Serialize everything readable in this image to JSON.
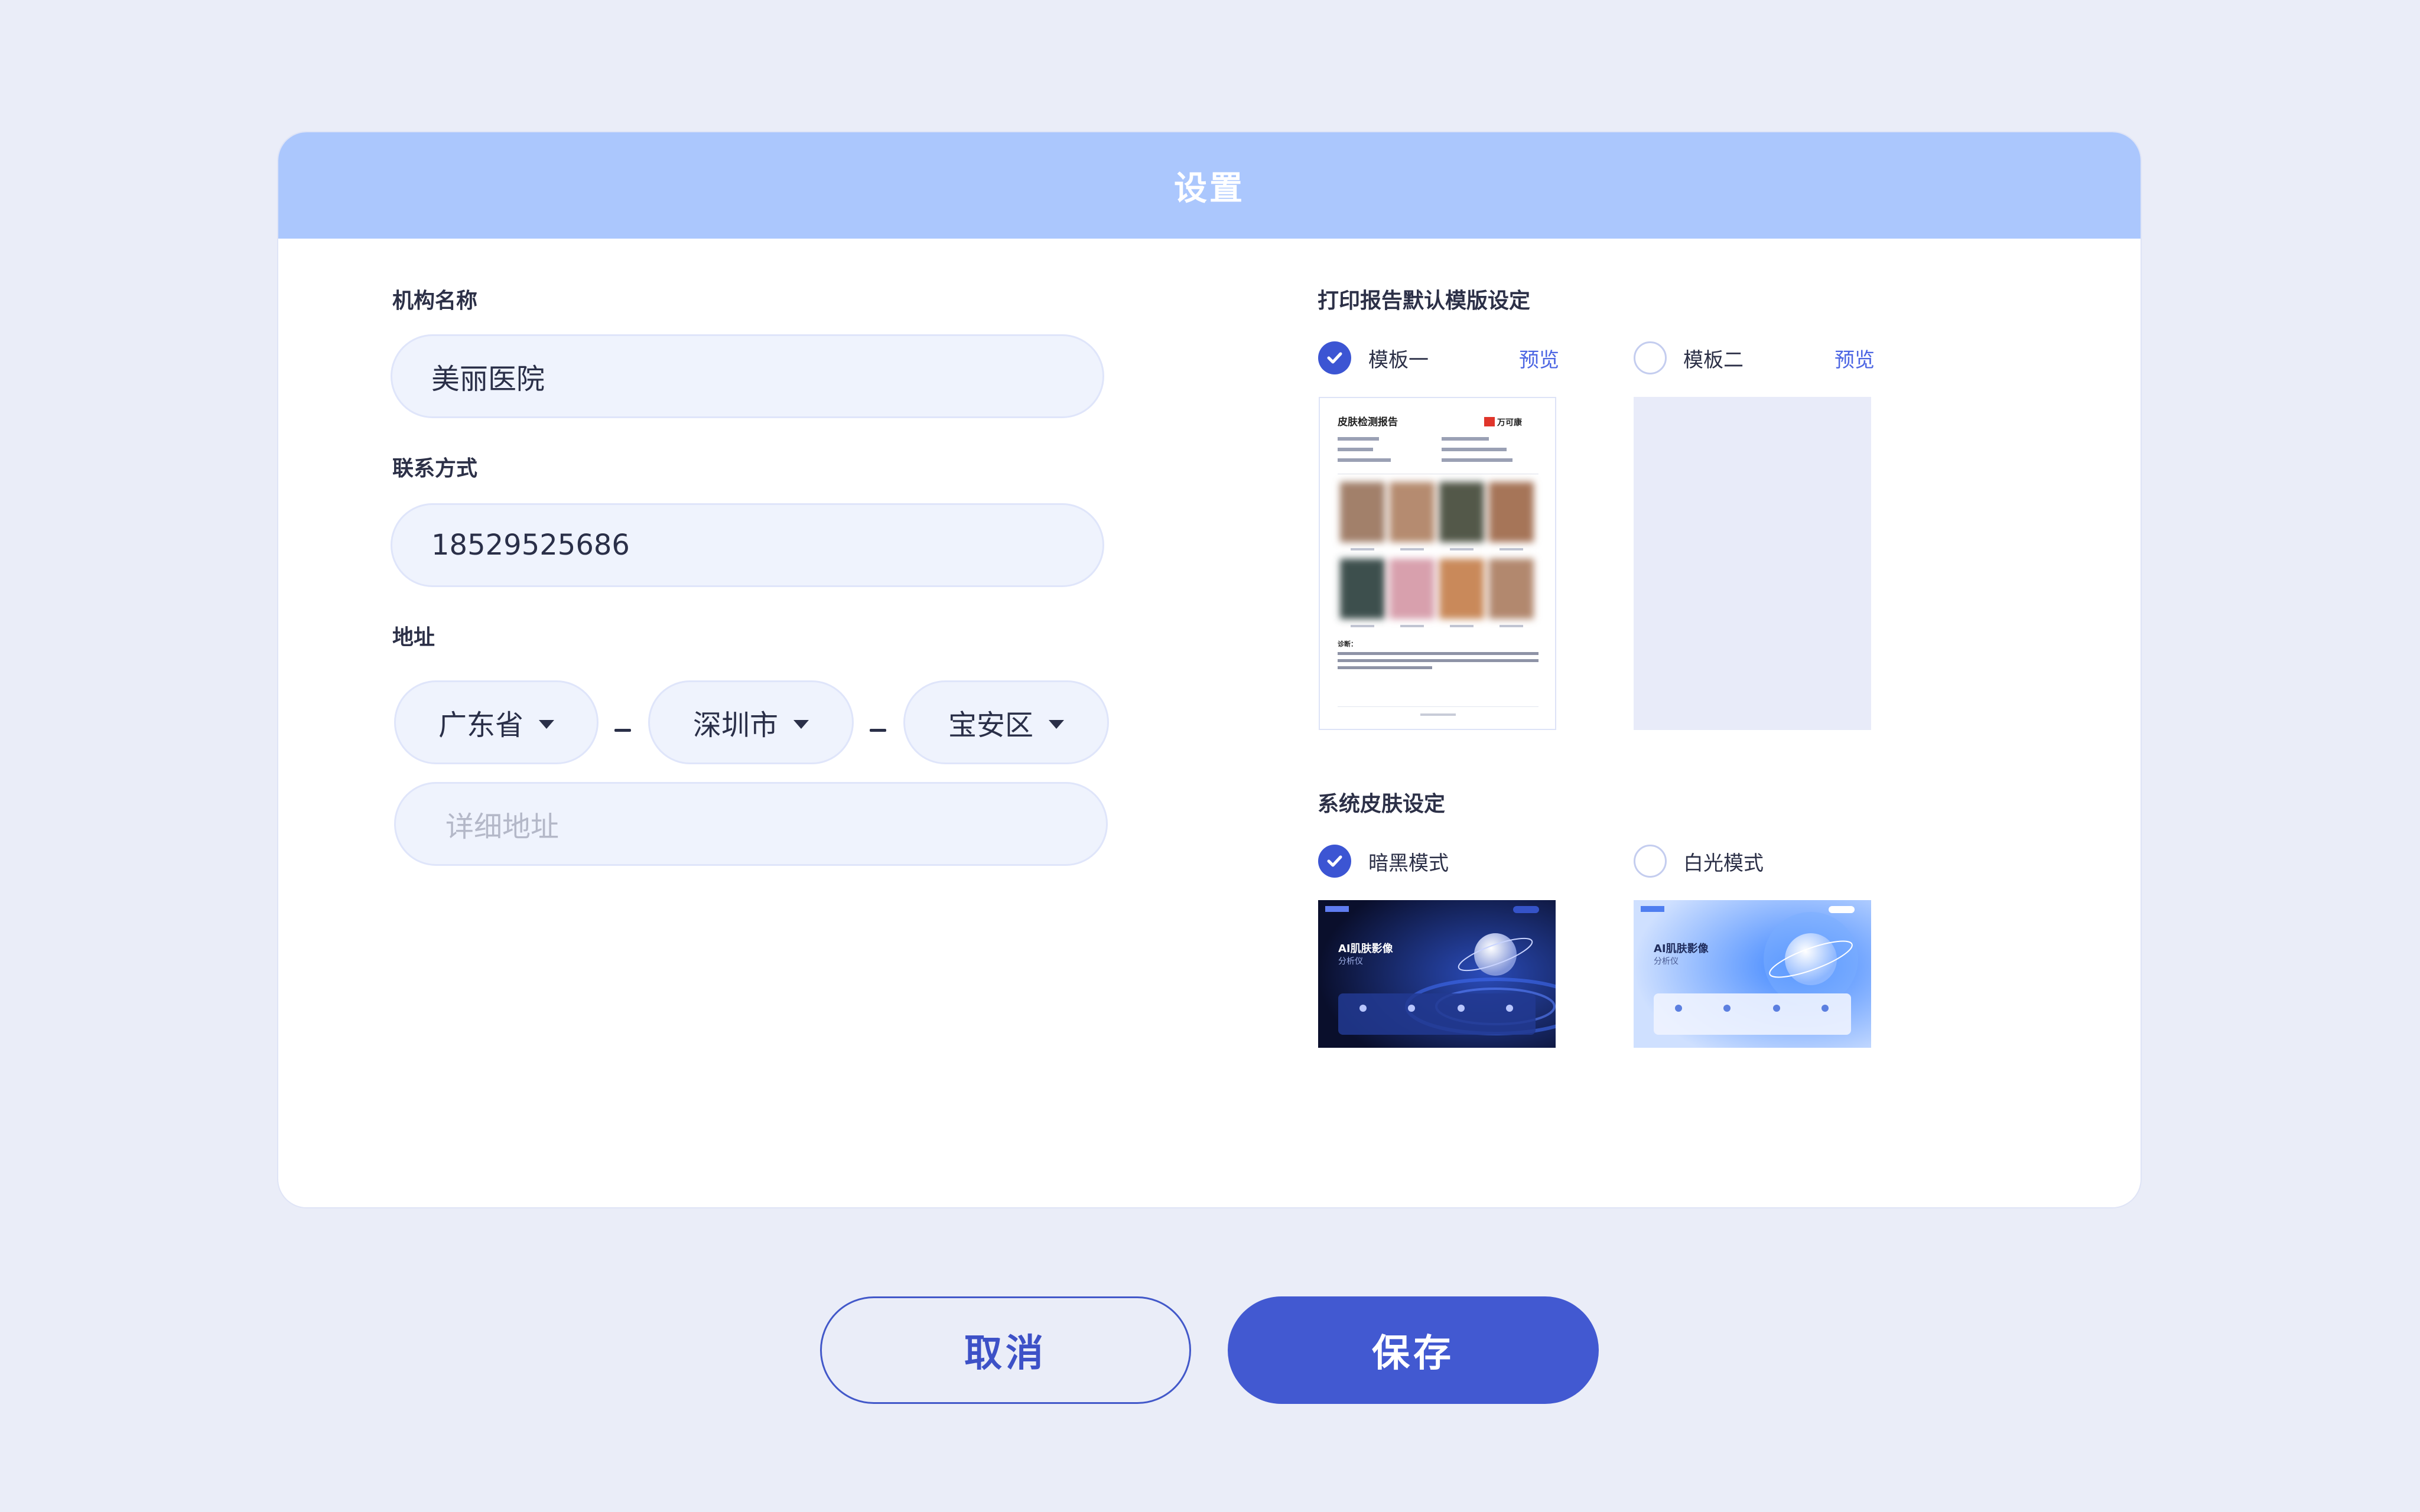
{
  "dialog": {
    "title": "设置"
  },
  "org": {
    "label": "机构名称",
    "value": "美丽医院"
  },
  "contact": {
    "label": "联系方式",
    "value": "18529525686"
  },
  "address": {
    "label": "地址",
    "province": "广东省",
    "city": "深圳市",
    "district": "宝安区",
    "detail_placeholder": "详细地址"
  },
  "report_template": {
    "label": "打印报告默认模版设定",
    "options": [
      {
        "label": "模板一",
        "preview": "预览",
        "selected": true
      },
      {
        "label": "模板二",
        "preview": "预览",
        "selected": false
      }
    ],
    "thumb": {
      "title": "皮肤检测报告",
      "logo": "万可康",
      "conclusion": "诊断："
    }
  },
  "skin": {
    "label": "系统皮肤设定",
    "options": [
      {
        "label": "暗黑模式",
        "selected": true
      },
      {
        "label": "白光模式",
        "selected": false
      }
    ],
    "thumb_title": "AI肌肤影像",
    "thumb_subtitle": "分析仪"
  },
  "actions": {
    "cancel": "取消",
    "save": "保存"
  },
  "colors": {
    "accent": "#4259d1",
    "header": "#abc7fd",
    "background": "#eaedf8"
  }
}
